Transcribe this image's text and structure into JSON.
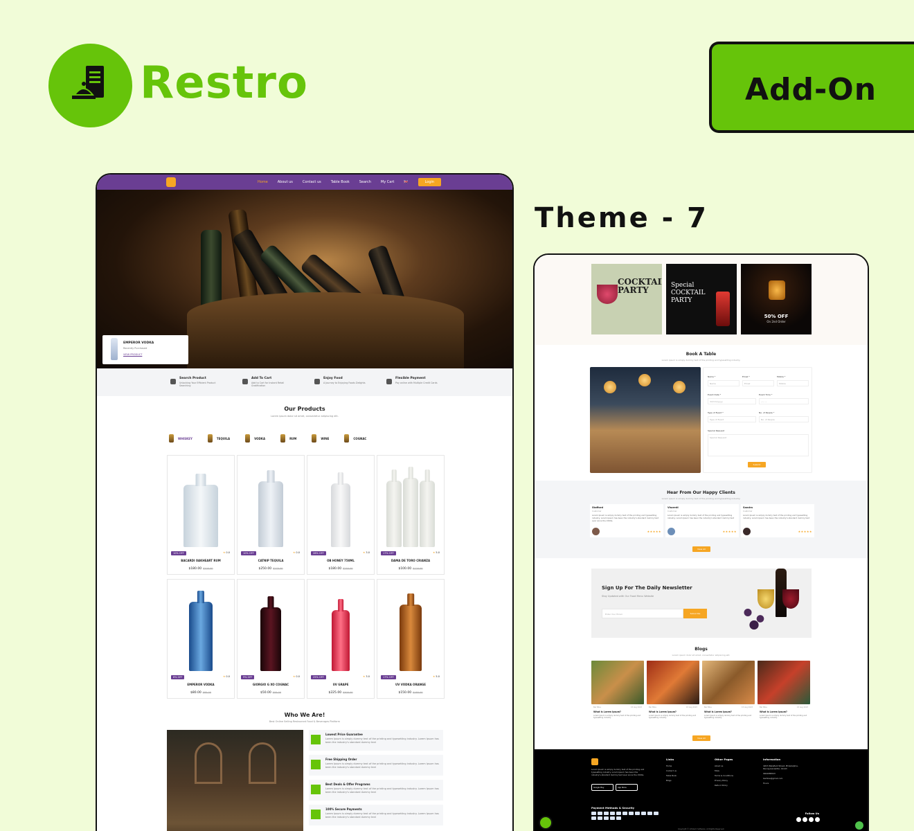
{
  "brand": {
    "name": "Restro",
    "accent": "#66c40a"
  },
  "addon_label": "Add-On",
  "theme_title": "Theme - 7",
  "left": {
    "nav": {
      "items": [
        "Home",
        "About us",
        "Contact us",
        "Table Book",
        "Search",
        "My Cart"
      ],
      "login": "Login",
      "color": "#6a3e93"
    },
    "hero_card": {
      "title": "EMPEROR VODKA",
      "sub": "Recently Purchased",
      "link": "VIEW PRODUCT"
    },
    "features": [
      {
        "title": "Search Product",
        "desc": "Unlocking Your Efficient Product Searching",
        "icon": "search-icon"
      },
      {
        "title": "Add To Cart",
        "desc": "Add to Cart for Instant Retail Gratification",
        "icon": "cart-icon"
      },
      {
        "title": "Enjoy Food",
        "desc": "A Journey to Enjoying Foods Delights",
        "icon": "truck-icon"
      },
      {
        "title": "Flexible Payment",
        "desc": "Pay online with Multiple Credit Cards",
        "icon": "card-icon"
      }
    ],
    "products_title": "Our Products",
    "products_sub": "Lorem ipsum dolor sit amet, consectetur adipiscing elit.",
    "categories": [
      "WHISKEY",
      "TEQUILA",
      "VODKA",
      "RUM",
      "WINE",
      "COGNAC"
    ],
    "products": [
      {
        "name": "BACARDI OAKHEART RUM",
        "price": "$180.00",
        "old": "$200.00",
        "discount": "10% OFF",
        "rating": "0.0"
      },
      {
        "name": "CATNIP TEQUILA",
        "price": "$250.00",
        "old": "$270.00",
        "discount": "10% OFF",
        "rating": "0.0"
      },
      {
        "name": "OB HONEY 750ML",
        "price": "$180.00",
        "old": "$250.00",
        "discount": "28% OFF",
        "rating": "3.0"
      },
      {
        "name": "DAMA DE TORO CRIANZA",
        "price": "$100.00",
        "old": "$120.00",
        "discount": "17% OFF",
        "rating": "5.0"
      },
      {
        "name": "EMPEROR VODKA",
        "price": "$80.00",
        "old": "$85.00",
        "discount": "6% OFF",
        "rating": "0.0"
      },
      {
        "name": "GIORGIO G XO COGNAC",
        "price": "$50.00",
        "old": "$55.00",
        "discount": "9% OFF",
        "rating": "0.0"
      },
      {
        "name": "UV GRAPE",
        "price": "$225.00",
        "old": "$300.00",
        "discount": "25% OFF",
        "rating": "3.0"
      },
      {
        "name": "UV VODKA ORANGE",
        "price": "$150.00",
        "old": "$180.00",
        "discount": "17% OFF",
        "rating": "5.0"
      }
    ],
    "who_title": "Who We Are!",
    "who_sub": "Best Online Selling Restaurant Food & Beverages Platform",
    "perks": [
      {
        "title": "Lowest Price Guarantee",
        "desc": "Lorem Ipsum is simply dummy text of the printing and typesetting industry. Lorem Ipsum has been the industry's standard dummy text"
      },
      {
        "title": "Free Shipping Order",
        "desc": "Lorem Ipsum is simply dummy text of the printing and typesetting industry. Lorem Ipsum has been the industry's standard dummy text"
      },
      {
        "title": "Best Deals & Offer Programs",
        "desc": "Lorem Ipsum is simply dummy text of the printing and typesetting industry. Lorem Ipsum has been the industry's standard dummy text"
      },
      {
        "title": "100% Secure Payments",
        "desc": "Lorem Ipsum is simply dummy text of the printing and typesetting industry. Lorem Ipsum has been the industry's standard dummy text"
      }
    ]
  },
  "right": {
    "banner1": "COCKTAIL PARTY",
    "banner2": "Special COCKTAIL PARTY",
    "banner3_title": "50% OFF",
    "banner3_sub": "On 2nd Order",
    "book": {
      "title": "Book A Table",
      "sub": "Lorem ipsum is simply dummy text of the printing and typesetting industry.",
      "labels": [
        "Name *",
        "Email *",
        "Mobile *",
        "Event Date *",
        "Event Time *",
        "Type of Event *",
        "No. of People *",
        "Special Request"
      ],
      "placeholders": [
        "Name",
        "Email",
        "Mobile",
        "dd/mm/yyyy",
        "--:-- --",
        "Type of Event",
        "No. of People",
        "Special Request"
      ],
      "submit": "Submit"
    },
    "clients": {
      "title": "Hear From Our Happy Clients",
      "sub": "Lorem ipsum is simply dummy text of the printing and typesetting industry.",
      "items": [
        {
          "name": "Stafford",
          "role": "Customer",
          "text": "Lorem Ipsum is simply dummy text of the printing and typesetting industry. Lorem Ipsum has been the industry's standard dummy text ever since the 1500s."
        },
        {
          "name": "Viscenti",
          "role": "Customer",
          "text": "Lorem Ipsum is simply dummy text of the printing and typesetting industry. Lorem Ipsum has been the industry's standard dummy text"
        },
        {
          "name": "Sandra",
          "role": "Customer",
          "text": "Lorem Ipsum is simply dummy text of the printing and typesetting industry. Lorem Ipsum has been the industry's standard dummy text"
        }
      ],
      "stars": "★★★★★",
      "view_all": "View All"
    },
    "newsletter": {
      "title": "Sign Up For The Daily Newsletter",
      "sub": "Stay Updated with Our Food Menu Website",
      "placeholder": "Enter Your Email",
      "button": "Subscribe"
    },
    "blogs": {
      "title": "Blogs",
      "sub": "Lorem ipsum dolor sit amet, consectetur adipiscing elit.",
      "items": [
        {
          "author": "Bar Bliss",
          "date": "15 Aug 2023",
          "title": "What is Lorem Ipsum?",
          "text": "Lorem Ipsum is simply dummy text of the printing and typesetting industry."
        },
        {
          "author": "Bar Bliss",
          "date": "15 Aug 2023",
          "title": "What is Lorem Ipsum?",
          "text": "Lorem Ipsum is simply dummy text of the printing and typesetting industry."
        },
        {
          "author": "Bar Bliss",
          "date": "15 Aug 2023",
          "title": "What is Lorem Ipsum?",
          "text": "Lorem Ipsum is simply dummy text of the printing and typesetting industry."
        },
        {
          "author": "Bar Bliss",
          "date": "15 Aug 2023",
          "title": "What is Lorem Ipsum?",
          "text": "Lorem Ipsum is simply dummy text of the printing and typesetting industry."
        }
      ],
      "view_all": "View All"
    },
    "footer": {
      "desc": "Lorem Ipsum is simply dummy text of the printing and typesetting industry. Lorem Ipsum has been the industry's standard dummy text ever since the 1500s.",
      "google_play": "Google Play",
      "app_store": "App Store",
      "links_title": "Links",
      "links": [
        "Home",
        "Contact us",
        "Table Book",
        "Blogs"
      ],
      "other_title": "Other Pages",
      "other": [
        "About us",
        "FAQs",
        "Terms & Conditions",
        "Privacy Policy",
        "Refund Policy"
      ],
      "info_title": "Information",
      "info": [
        "4203 Wakefield Street, Philadelphia, Pennsylvania(PA), 19143",
        "9944086543",
        "barbliss@gmail.com",
        "Hours"
      ],
      "payment_title": "Payment Methods & Security",
      "follow": "Follow Us",
      "copyright": "Copyright © Infotech Software. All Rights Reserved."
    }
  }
}
